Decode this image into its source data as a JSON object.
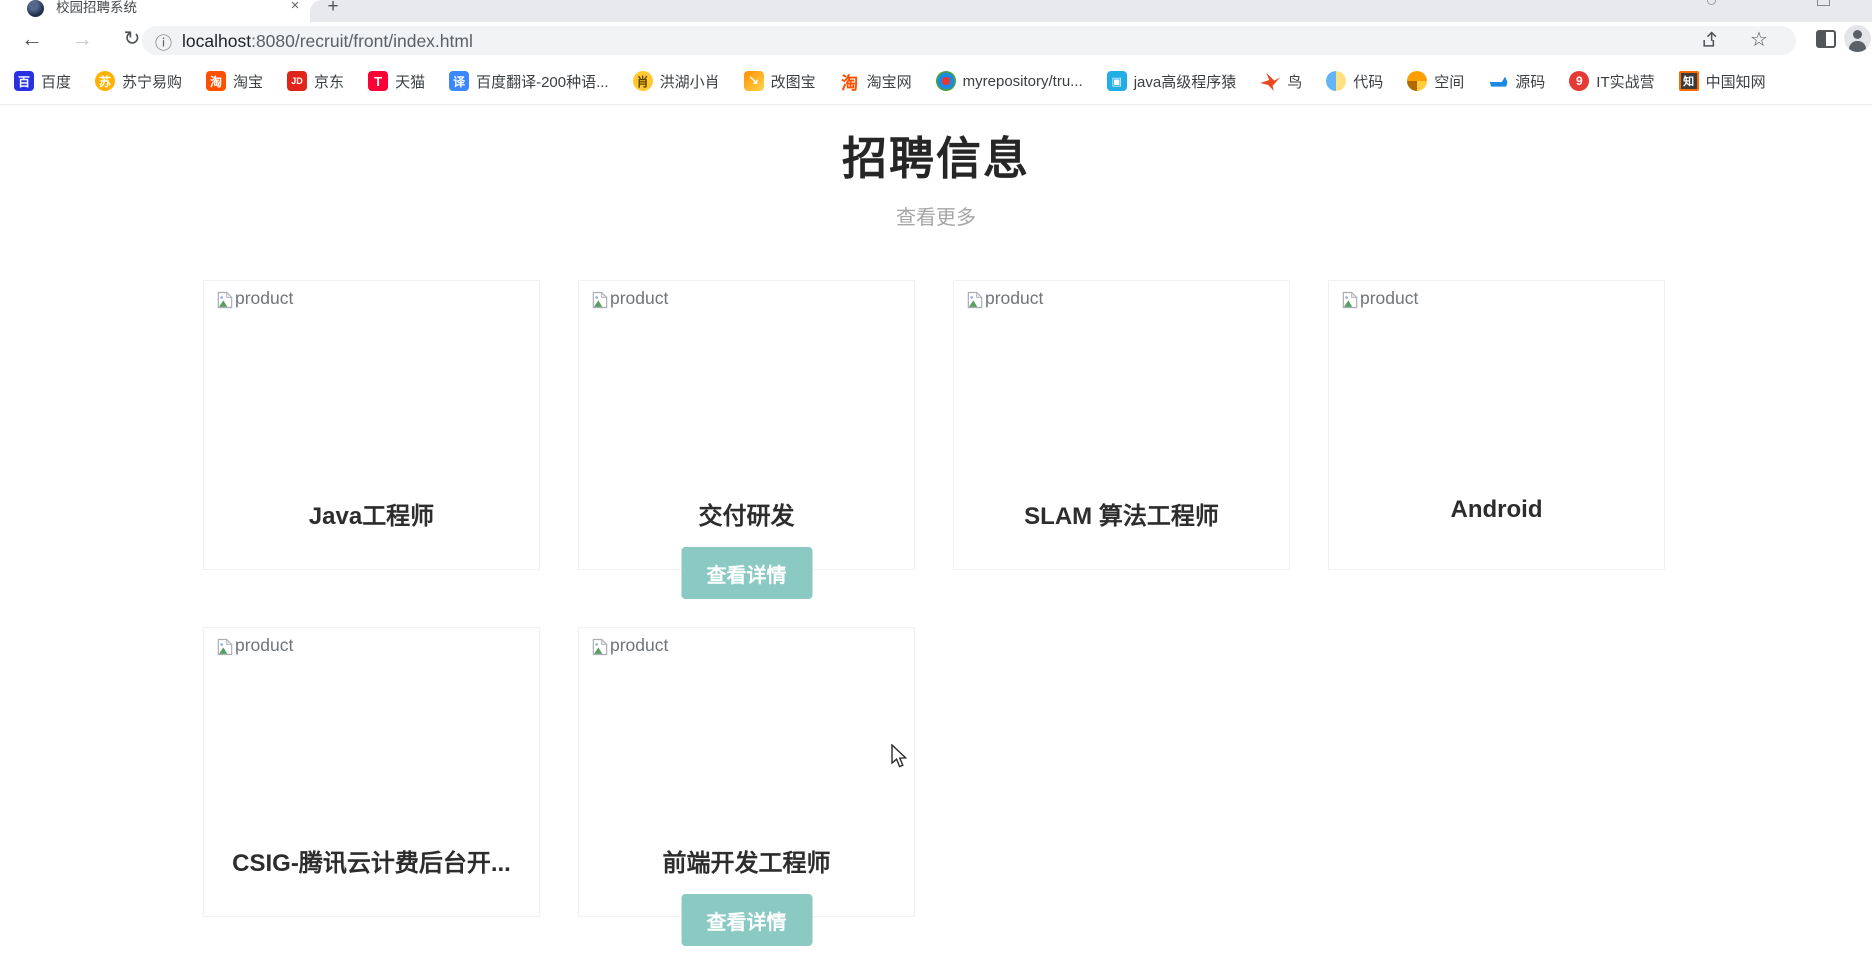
{
  "browser": {
    "tab": {
      "title": "校园招聘系统"
    },
    "icons": {
      "close": "×",
      "new_tab": "+",
      "back": "←",
      "forward": "→",
      "reload": "↻",
      "info": "ⓘ",
      "star": "☆"
    },
    "omnibox": {
      "host": "localhost",
      "path": ":8080/recruit/front/index.html",
      "full_url": "localhost:8080/recruit/front/index.html"
    },
    "bookmarks": [
      {
        "label": "百度",
        "glyph": "百"
      },
      {
        "label": "苏宁易购",
        "glyph": "苏"
      },
      {
        "label": "淘宝",
        "glyph": "淘"
      },
      {
        "label": "京东",
        "glyph": "JD"
      },
      {
        "label": "天猫",
        "glyph": "T"
      },
      {
        "label": "百度翻译-200种语...",
        "glyph": "译"
      },
      {
        "label": "洪湖小肖",
        "glyph": "肖"
      },
      {
        "label": "改图宝",
        "glyph": "↘"
      },
      {
        "label": "淘宝网",
        "glyph": "淘"
      },
      {
        "label": "myrepository/tru...",
        "glyph": ""
      },
      {
        "label": "java高级程序猿",
        "glyph": "▣"
      },
      {
        "label": "鸟",
        "glyph": ""
      },
      {
        "label": "代码",
        "glyph": ""
      },
      {
        "label": "空间",
        "glyph": ""
      },
      {
        "label": "源码",
        "glyph": ""
      },
      {
        "label": "IT实战营",
        "glyph": "9"
      },
      {
        "label": "中国知网",
        "glyph": "知"
      }
    ]
  },
  "page": {
    "heading": "招聘信息",
    "view_more": "查看更多",
    "accent_color": "#8bc9c3",
    "cards": [
      {
        "title": "Java工程师",
        "image_alt": "product"
      },
      {
        "title": "交付研发",
        "image_alt": "product",
        "button_label": "查看详情"
      },
      {
        "title": "SLAM 算法工程师",
        "image_alt": "product"
      },
      {
        "title": "Android",
        "image_alt": "product"
      },
      {
        "title": "CSIG-腾讯云计费后台开...",
        "image_alt": "product"
      },
      {
        "title": "前端开发工程师",
        "image_alt": "product",
        "button_label": "查看详情"
      }
    ]
  }
}
